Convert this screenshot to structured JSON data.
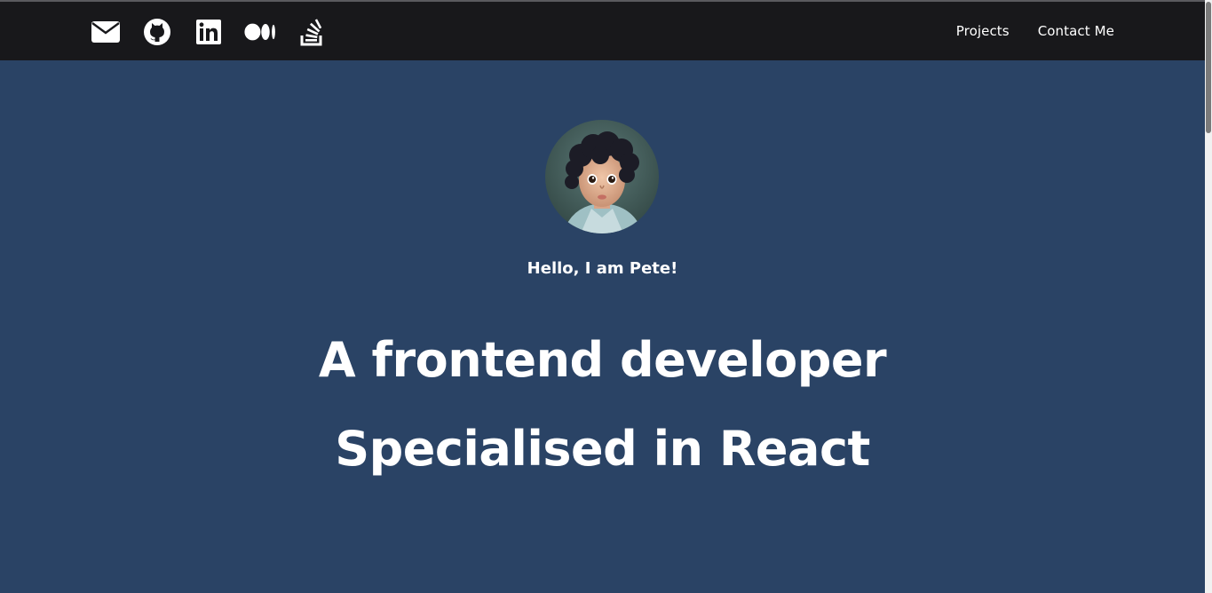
{
  "header": {
    "socials": [
      {
        "name": "envelope-icon"
      },
      {
        "name": "github-icon"
      },
      {
        "name": "linkedin-icon"
      },
      {
        "name": "medium-icon"
      },
      {
        "name": "stackoverflow-icon"
      }
    ],
    "nav": {
      "projects": "Projects",
      "contact": "Contact Me"
    }
  },
  "hero": {
    "greeting": "Hello, I am Pete!",
    "headline_line1": "A frontend developer",
    "headline_line2": "Specialised in React"
  },
  "colors": {
    "header_bg": "#18181b",
    "hero_bg": "#2a4365",
    "text": "#ffffff"
  }
}
